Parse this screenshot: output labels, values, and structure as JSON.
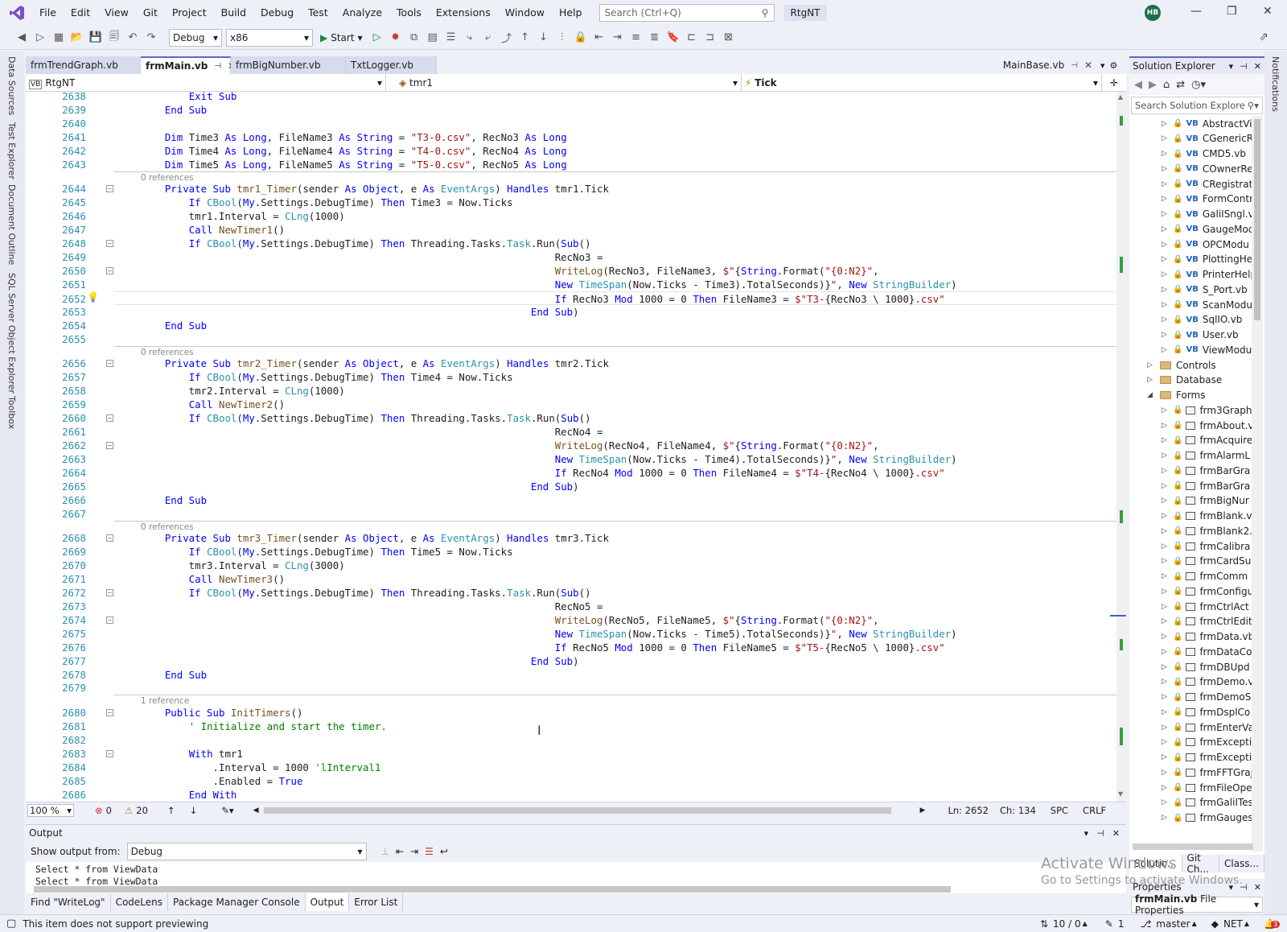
{
  "menubar": {
    "items": [
      "File",
      "Edit",
      "View",
      "Git",
      "Project",
      "Build",
      "Debug",
      "Test",
      "Analyze",
      "Tools",
      "Extensions",
      "Window",
      "Help"
    ],
    "search_placeholder": "Search (Ctrl+Q)",
    "solution_name": "RtgNT",
    "avatar": "HB"
  },
  "toolbar": {
    "config": "Debug",
    "platform": "x86",
    "start": "Start"
  },
  "left_rail": [
    "Data Sources",
    "Test Explorer",
    "Document Outline",
    "SQL Server Object Explorer",
    "Toolbox"
  ],
  "right_rail": [
    "Notifications"
  ],
  "tabs": [
    {
      "label": "frmTrendGraph.vb",
      "active": false
    },
    {
      "label": "frmMain.vb",
      "active": true
    },
    {
      "label": "frmBigNumber.vb",
      "active": false
    },
    {
      "label": "TxtLogger.vb",
      "active": false
    }
  ],
  "pinned_tab": "MainBase.vb",
  "navbar": {
    "project": "RtgNT",
    "object": "tmr1",
    "member": "Tick"
  },
  "code_lines": [
    {
      "n": "2638",
      "html": "        <span class='kw'>Exit Sub</span>"
    },
    {
      "n": "2639",
      "html": "    <span class='kw'>End Sub</span>"
    },
    {
      "n": "2640",
      "html": ""
    },
    {
      "n": "2641",
      "html": "    <span class='kw'>Dim</span> Time3 <span class='kw'>As Long</span>, FileName3 <span class='kw'>As String</span> = <span class='st'>\"T3-0.csv\"</span>, RecNo3 <span class='kw'>As Long</span>"
    },
    {
      "n": "2642",
      "html": "    <span class='kw'>Dim</span> Time4 <span class='kw'>As Long</span>, FileName4 <span class='kw'>As String</span> = <span class='st'>\"T4-0.csv\"</span>, RecNo4 <span class='kw'>As Long</span>"
    },
    {
      "n": "2643",
      "html": "    <span class='kw'>Dim</span> Time5 <span class='kw'>As Long</span>, FileName5 <span class='kw'>As String</span> = <span class='st'>\"T5-0.csv\"</span>, RecNo5 <span class='kw'>As Long</span>"
    },
    {
      "n": "2644",
      "html": "    <span class='kw'>Private Sub</span> <span class='fn'>tmr1_Timer</span>(sender <span class='kw'>As Object</span>, e <span class='kw'>As</span> <span class='tp'>EventArgs</span>) <span class='kw'>Handles</span> tmr1.Tick"
    },
    {
      "n": "2645",
      "html": "        <span class='kw'>If</span> <span class='tp'>CBool</span>(<span class='kw'>My</span>.Settings.DebugTime) <span class='kw'>Then</span> Time3 = Now.Ticks"
    },
    {
      "n": "2646",
      "html": "        tmr1.Interval = <span class='tp'>CLng</span>(1000)"
    },
    {
      "n": "2647",
      "html": "        <span class='kw'>Call</span> <span class='fn'>NewTimer1</span>()"
    },
    {
      "n": "2648",
      "html": "        <span class='kw'>If</span> <span class='tp'>CBool</span>(<span class='kw'>My</span>.Settings.DebugTime) <span class='kw'>Then</span> Threading.Tasks.<span class='tp'>Task</span>.Run(<span class='kw'>Sub</span>()"
    },
    {
      "n": "2649",
      "html": "                                                                     RecNo3 ="
    },
    {
      "n": "2650",
      "html": "                                                                     <span class='fn'>WriteLog</span>(RecNo3, FileName3, <span class='st'>$\"</span>{<span class='kw'>String</span>.Format(<span class='st'>\"{0:N2}\"</span>,"
    },
    {
      "n": "2651",
      "html": "                                                                     <span class='kw'>New</span> <span class='tp'>TimeSpan</span>(Now.Ticks - Time3).TotalSeconds)}<span class='st'>\"</span>, <span class='kw'>New</span> <span class='tp'>StringBuilder</span>)"
    },
    {
      "n": "2652",
      "html": "                                                                     <span class='kw'>If</span> RecNo3 <span class='kw'>Mod</span> 1000 = 0 <span class='kw'>Then</span> FileName3 = <span class='st'>$\"T3-</span>{RecNo3 \\ 1000}<span class='st'>.csv\"</span>"
    },
    {
      "n": "2653",
      "html": "                                                                 <span class='kw'>End Sub</span>)"
    },
    {
      "n": "2654",
      "html": "    <span class='kw'>End Sub</span>"
    },
    {
      "n": "2655",
      "html": ""
    },
    {
      "n": "2656",
      "html": "    <span class='kw'>Private Sub</span> <span class='fn'>tmr2_Timer</span>(sender <span class='kw'>As Object</span>, e <span class='kw'>As</span> <span class='tp'>EventArgs</span>) <span class='kw'>Handles</span> tmr2.Tick"
    },
    {
      "n": "2657",
      "html": "        <span class='kw'>If</span> <span class='tp'>CBool</span>(<span class='kw'>My</span>.Settings.DebugTime) <span class='kw'>Then</span> Time4 = Now.Ticks"
    },
    {
      "n": "2658",
      "html": "        tmr2.Interval = <span class='tp'>CLng</span>(1000)"
    },
    {
      "n": "2659",
      "html": "        <span class='kw'>Call</span> <span class='fn'>NewTimer2</span>()"
    },
    {
      "n": "2660",
      "html": "        <span class='kw'>If</span> <span class='tp'>CBool</span>(<span class='kw'>My</span>.Settings.DebugTime) <span class='kw'>Then</span> Threading.Tasks.<span class='tp'>Task</span>.Run(<span class='kw'>Sub</span>()"
    },
    {
      "n": "2661",
      "html": "                                                                     RecNo4 ="
    },
    {
      "n": "2662",
      "html": "                                                                     <span class='fn'>WriteLog</span>(RecNo4, FileName4, <span class='st'>$\"</span>{<span class='kw'>String</span>.Format(<span class='st'>\"{0:N2}\"</span>,"
    },
    {
      "n": "2663",
      "html": "                                                                     <span class='kw'>New</span> <span class='tp'>TimeSpan</span>(Now.Ticks - Time4).TotalSeconds)}<span class='st'>\"</span>, <span class='kw'>New</span> <span class='tp'>StringBuilder</span>)"
    },
    {
      "n": "2664",
      "html": "                                                                     <span class='kw'>If</span> RecNo4 <span class='kw'>Mod</span> 1000 = 0 <span class='kw'>Then</span> FileName4 = <span class='st'>$\"T4-</span>{RecNo4 \\ 1000}<span class='st'>.csv\"</span>"
    },
    {
      "n": "2665",
      "html": "                                                                 <span class='kw'>End Sub</span>)"
    },
    {
      "n": "2666",
      "html": "    <span class='kw'>End Sub</span>"
    },
    {
      "n": "2667",
      "html": ""
    },
    {
      "n": "2668",
      "html": "    <span class='kw'>Private Sub</span> <span class='fn'>tmr3_Timer</span>(sender <span class='kw'>As Object</span>, e <span class='kw'>As</span> <span class='tp'>EventArgs</span>) <span class='kw'>Handles</span> tmr3.Tick"
    },
    {
      "n": "2669",
      "html": "        <span class='kw'>If</span> <span class='tp'>CBool</span>(<span class='kw'>My</span>.Settings.DebugTime) <span class='kw'>Then</span> Time5 = Now.Ticks"
    },
    {
      "n": "2670",
      "html": "        tmr3.Interval = <span class='tp'>CLng</span>(3000)"
    },
    {
      "n": "2671",
      "html": "        <span class='kw'>Call</span> <span class='fn'>NewTimer3</span>()"
    },
    {
      "n": "2672",
      "html": "        <span class='kw'>If</span> <span class='tp'>CBool</span>(<span class='kw'>My</span>.Settings.DebugTime) <span class='kw'>Then</span> Threading.Tasks.<span class='tp'>Task</span>.Run(<span class='kw'>Sub</span>()"
    },
    {
      "n": "2673",
      "html": "                                                                     RecNo5 ="
    },
    {
      "n": "2674",
      "html": "                                                                     <span class='fn'>WriteLog</span>(RecNo5, FileName5, <span class='st'>$\"</span>{<span class='kw'>String</span>.Format(<span class='st'>\"{0:N2}\"</span>,"
    },
    {
      "n": "2675",
      "html": "                                                                     <span class='kw'>New</span> <span class='tp'>TimeSpan</span>(Now.Ticks - Time5).TotalSeconds)}<span class='st'>\"</span>, <span class='kw'>New</span> <span class='tp'>StringBuilder</span>)"
    },
    {
      "n": "2676",
      "html": "                                                                     <span class='kw'>If</span> RecNo5 <span class='kw'>Mod</span> 1000 = 0 <span class='kw'>Then</span> FileName5 = <span class='st'>$\"T5-</span>{RecNo5 \\ 1000}<span class='st'>.csv\"</span>"
    },
    {
      "n": "2677",
      "html": "                                                                 <span class='kw'>End Sub</span>)"
    },
    {
      "n": "2678",
      "html": "    <span class='kw'>End Sub</span>"
    },
    {
      "n": "2679",
      "html": ""
    },
    {
      "n": "2680",
      "html": "    <span class='kw'>Public Sub</span> <span class='fn'>InitTimers</span>()"
    },
    {
      "n": "2681",
      "html": "        <span class='cm'>' Initialize and start the timer.</span>"
    },
    {
      "n": "2682",
      "html": ""
    },
    {
      "n": "2683",
      "html": "        <span class='kw'>With</span> tmr1"
    },
    {
      "n": "2684",
      "html": "            .Interval = 1000 <span class='cm'>'lInterval1</span>"
    },
    {
      "n": "2685",
      "html": "            .Enabled = <span class='kw'>True</span>"
    },
    {
      "n": "2686",
      "html": "        <span class='kw'>End With</span>"
    }
  ],
  "ref_labels": [
    "0 references",
    "0 references",
    "0 references",
    "1 reference"
  ],
  "editor_status": {
    "zoom": "100 %",
    "errors": "0",
    "warnings": "20",
    "ln": "Ln: 2652",
    "ch": "Ch: 134",
    "spc": "SPC",
    "crlf": "CRLF"
  },
  "output": {
    "title": "Output",
    "show_from_label": "Show output from:",
    "source": "Debug",
    "lines": [
      "Select * from ViewData",
      "Select * from ViewData"
    ]
  },
  "bottom_tabs": [
    {
      "label": "Find \"WriteLog\"",
      "active": false
    },
    {
      "label": "CodeLens",
      "active": false
    },
    {
      "label": "Package Manager Console",
      "active": false
    },
    {
      "label": "Output",
      "active": true
    },
    {
      "label": "Error List",
      "active": false
    }
  ],
  "statusbar": {
    "message": "This item does not support previewing",
    "lines": "10 / 0",
    "edits": "1",
    "branch": "master",
    "net": "NET",
    "notif": "3"
  },
  "solution_explorer": {
    "title": "Solution Explorer",
    "search_placeholder": "Search Solution Explore",
    "vb_items": [
      "AbstractVie",
      "CGenericRe",
      "CMD5.vb",
      "COwnerRe",
      "CRegistrati",
      "FormContr",
      "GaliISngl.vl",
      "GaugeMoc",
      "OPCModu",
      "PlottingHe",
      "PrinterHelp",
      "S_Port.vb",
      "ScanModu",
      "SqlIO.vb",
      "User.vb",
      "ViewModu"
    ],
    "folders": [
      "Controls",
      "Database",
      "Forms"
    ],
    "forms": [
      "frm3Graph",
      "frmAbout.v",
      "frmAcquire",
      "frmAlarmL",
      "frmBarGra",
      "frmBarGra",
      "frmBigNur",
      "frmBlank.v",
      "frmBlank2.",
      "frmCalibra",
      "frmCardSu",
      "frmComm",
      "frmConfigu",
      "frmCtrlAct",
      "frmCtrlEdit",
      "frmData.vb",
      "frmDataCo",
      "frmDBUpd",
      "frmDemo.v",
      "frmDemoS",
      "frmDsplCo",
      "frmEnterVa",
      "frmExcepti",
      "frmExcepti",
      "frmFFTGraj",
      "frmFileOpe",
      "frmGaliITes",
      "frmGauges"
    ],
    "tabs": [
      "Solutio...",
      "Git Ch...",
      "Class..."
    ]
  },
  "properties": {
    "title": "Properties",
    "item": "frmMain.vb",
    "kind": "File Properties"
  },
  "watermark": {
    "line1": "Activate Windows",
    "line2": "Go to Settings to activate Windows."
  }
}
